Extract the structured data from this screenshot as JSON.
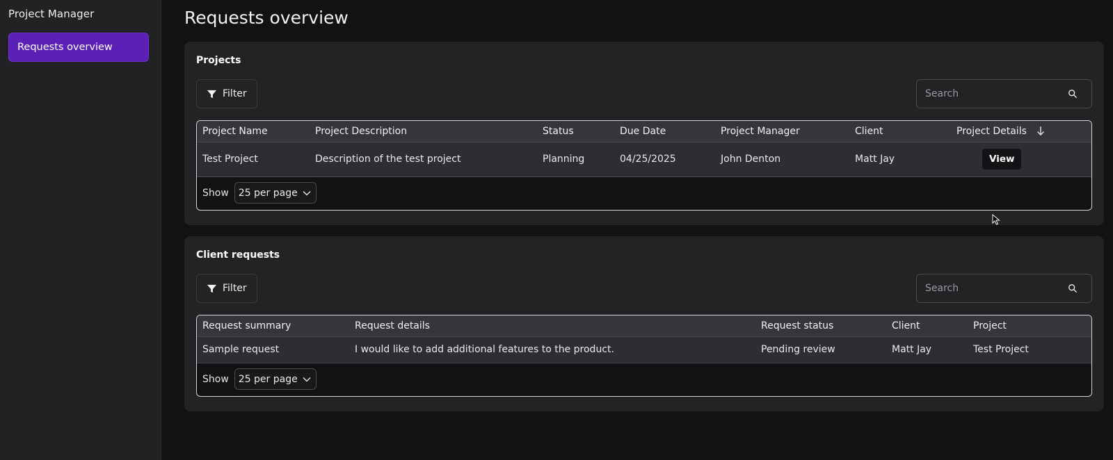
{
  "app": {
    "title": "Project Manager"
  },
  "sidebar": {
    "items": [
      {
        "label": "Requests overview",
        "active": true
      }
    ]
  },
  "page": {
    "title": "Requests overview"
  },
  "projects": {
    "title": "Projects",
    "filter_label": "Filter",
    "search_placeholder": "Search",
    "columns": [
      "Project Name",
      "Project Description",
      "Status",
      "Due Date",
      "Project Manager",
      "Client",
      "Project Details"
    ],
    "rows": [
      {
        "name": "Test Project",
        "description": "Description of the test project",
        "status": "Planning",
        "due_date": "04/25/2025",
        "manager": "John Denton",
        "client": "Matt Jay",
        "details_label": "View"
      }
    ],
    "pagination": {
      "show_label": "Show",
      "per_page": "25 per page"
    }
  },
  "requests": {
    "title": "Client requests",
    "filter_label": "Filter",
    "search_placeholder": "Search",
    "columns": [
      "Request summary",
      "Request details",
      "Request status",
      "Client",
      "Project"
    ],
    "rows": [
      {
        "summary": "Sample request",
        "details": "I would like to add additional features to the product.",
        "status": "Pending review",
        "client": "Matt Jay",
        "project": "Test Project"
      }
    ],
    "pagination": {
      "show_label": "Show",
      "per_page": "25 per page"
    }
  },
  "icons": {
    "filter": "filter-icon",
    "search": "search-icon",
    "sort": "arrow-down-icon",
    "chevron": "chevron-down-icon"
  },
  "colors": {
    "accent": "#5b21b6",
    "background": "#131113",
    "sidebar": "#222224",
    "card": "#232326"
  }
}
